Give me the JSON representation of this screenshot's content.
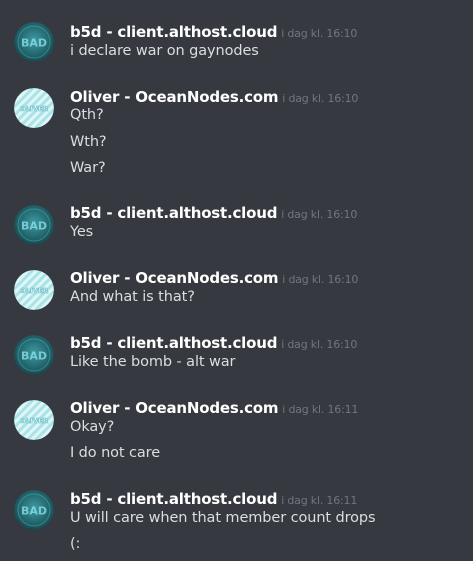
{
  "colors": {
    "background": "#36393f",
    "username": "#ffffff",
    "timestamp": "#72767d",
    "message": "#dcddde",
    "b5d_avatar": "#1f5f66",
    "oliver_avatar": "#dff6f7"
  },
  "avatars": {
    "b5d": {
      "icon": "b5d-server-avatar-icon",
      "text": "BAD"
    },
    "oliver": {
      "icon": "oliver-avatar-icon",
      "text": "OLIVER"
    }
  },
  "messages": [
    {
      "author": "b5d - client.althost.cloud",
      "time": "i dag kl. 16:10",
      "lines": [
        "i declare war on gaynodes"
      ]
    },
    {
      "author": "Oliver - OceanNodes.com",
      "time": "i dag kl. 16:10",
      "lines": [
        "Qth?",
        "Wth?",
        "War?"
      ]
    },
    {
      "author": "b5d - client.althost.cloud",
      "time": "i dag kl. 16:10",
      "lines": [
        "Yes"
      ]
    },
    {
      "author": "Oliver - OceanNodes.com",
      "time": "i dag kl. 16:10",
      "lines": [
        "And what is that?"
      ]
    },
    {
      "author": "b5d - client.althost.cloud",
      "time": "i dag kl. 16:10",
      "lines": [
        "Like the bomb - alt war"
      ]
    },
    {
      "author": "Oliver - OceanNodes.com",
      "time": "i dag kl. 16:11",
      "lines": [
        "Okay?",
        "I do not care"
      ]
    },
    {
      "author": "b5d - client.althost.cloud",
      "time": "i dag kl. 16:11",
      "lines": [
        "U will care when that member count drops",
        "(:"
      ]
    }
  ]
}
